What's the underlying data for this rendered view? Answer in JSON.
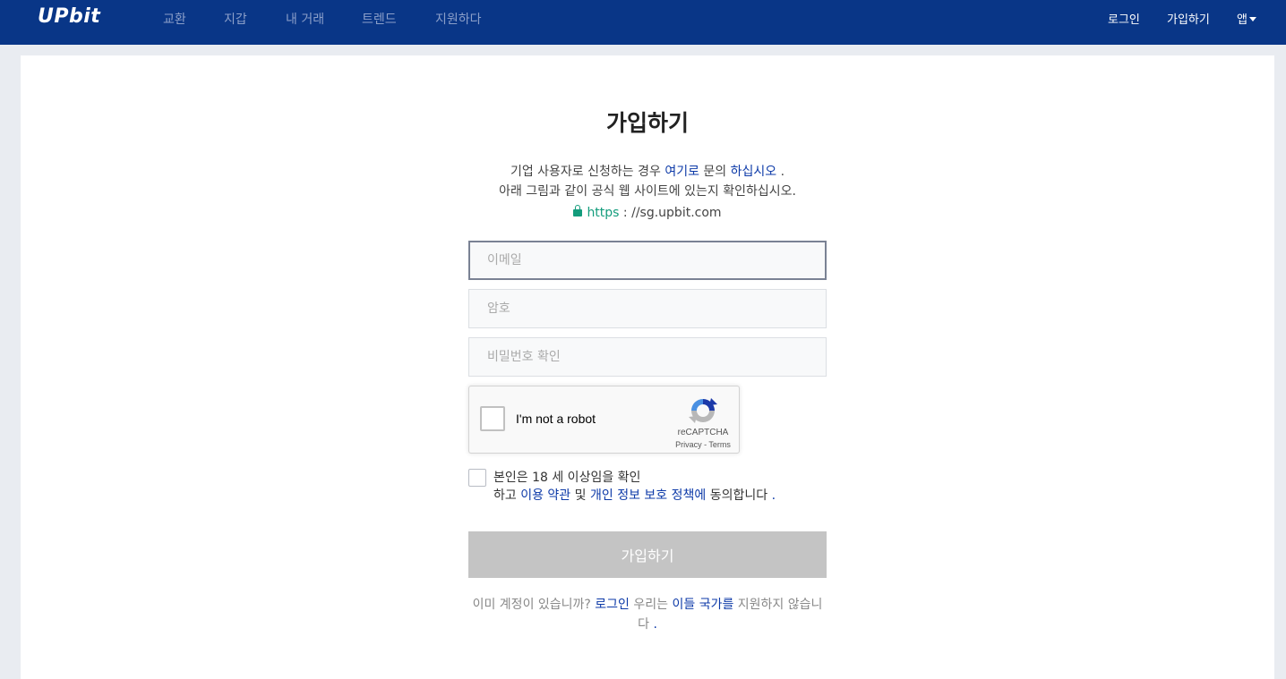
{
  "header": {
    "logo": "UPbit",
    "nav": [
      "교환",
      "지갑",
      "내 거래",
      "트렌드",
      "지원하다"
    ],
    "login": "로그인",
    "signup": "가입하기",
    "app": "앱"
  },
  "form": {
    "title": "가입하기",
    "notice_line1_a": "기업 사용자로 신청하는 경우 ",
    "notice_line1_link1": "여기로",
    "notice_line1_b": " 문의 ",
    "notice_line1_link2": "하십시오",
    "notice_line1_c": " .",
    "notice_line2": "아래 그림과 같이 공식 웹 사이트에 있는지 확인하십시오.",
    "url_scheme": "https",
    "url_rest": " : //sg.upbit.com",
    "email_placeholder": "이메일",
    "password_placeholder": "암호",
    "password_confirm_placeholder": "비밀번호 확인",
    "agree_line1": "본인은 18 세 이상임을 확인",
    "agree_line2_a": "하고 ",
    "agree_terms_link": "이용 약관",
    "agree_line2_b": " 및 ",
    "agree_privacy_link": "개인 정보 보호 정책에",
    "agree_line2_c": " 동의합니다 ",
    "agree_line2_d": ".",
    "submit_label": "가입하기",
    "footer_a": "이미 계정이 있습니까? ",
    "footer_login_link": "로그인",
    "footer_b": " 우리는 ",
    "footer_countries_link": "이들 국가를",
    "footer_c": " 지원하지 않습니다 ",
    "footer_d": "."
  },
  "recaptcha": {
    "label": "I'm not a robot",
    "brand": "reCAPTCHA",
    "terms": "Privacy - Terms"
  },
  "colors": {
    "header_bg": "#093687",
    "link": "#0d3aa8",
    "secure": "#139c7c",
    "submit_disabled": "#c4c4c4"
  }
}
